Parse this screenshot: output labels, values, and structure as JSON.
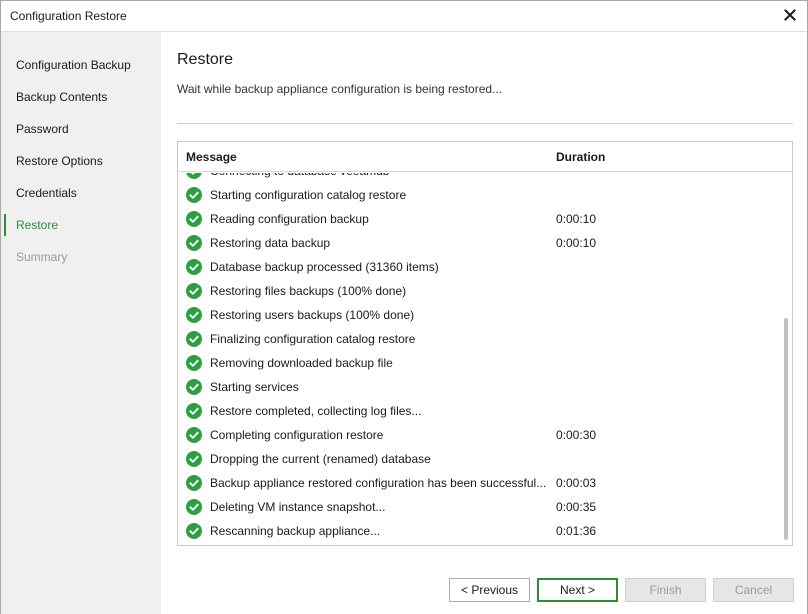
{
  "window": {
    "title": "Configuration Restore"
  },
  "sidebar": {
    "items": [
      {
        "label": "Configuration Backup",
        "state": "normal"
      },
      {
        "label": "Backup Contents",
        "state": "normal"
      },
      {
        "label": "Password",
        "state": "normal"
      },
      {
        "label": "Restore Options",
        "state": "normal"
      },
      {
        "label": "Credentials",
        "state": "normal"
      },
      {
        "label": "Restore",
        "state": "active"
      },
      {
        "label": "Summary",
        "state": "disabled"
      }
    ]
  },
  "main": {
    "heading": "Restore",
    "subtitle": "Wait while backup appliance configuration is being restored...",
    "table": {
      "columns": [
        "Message",
        "Duration"
      ],
      "rows": [
        {
          "message": "Connecting to database veeamdb",
          "duration": ""
        },
        {
          "message": "Starting configuration catalog restore",
          "duration": ""
        },
        {
          "message": "Reading configuration backup",
          "duration": "0:00:10"
        },
        {
          "message": "Restoring data backup",
          "duration": "0:00:10"
        },
        {
          "message": "Database backup processed (31360 items)",
          "duration": ""
        },
        {
          "message": "Restoring files backups (100% done)",
          "duration": ""
        },
        {
          "message": "Restoring users backups (100% done)",
          "duration": ""
        },
        {
          "message": "Finalizing configuration catalog restore",
          "duration": ""
        },
        {
          "message": "Removing downloaded backup file",
          "duration": ""
        },
        {
          "message": "Starting services",
          "duration": ""
        },
        {
          "message": "Restore completed, collecting log files...",
          "duration": ""
        },
        {
          "message": "Completing configuration restore",
          "duration": "0:00:30"
        },
        {
          "message": "Dropping the current (renamed) database",
          "duration": ""
        },
        {
          "message": "Backup appliance restored configuration has been successful...",
          "duration": "0:00:03"
        },
        {
          "message": "Deleting VM instance snapshot...",
          "duration": "0:00:35"
        },
        {
          "message": "Rescanning backup appliance...",
          "duration": "0:01:36"
        }
      ]
    }
  },
  "footer": {
    "previous_label": "< Previous",
    "next_label": "Next >",
    "finish_label": "Finish",
    "cancel_label": "Cancel"
  },
  "colors": {
    "accent": "#2e8b3a",
    "success_icon": "#2ea043",
    "sidebar_bg": "#f0f0f0"
  },
  "icons": {
    "close": "close-icon",
    "status": "success-check-icon"
  }
}
